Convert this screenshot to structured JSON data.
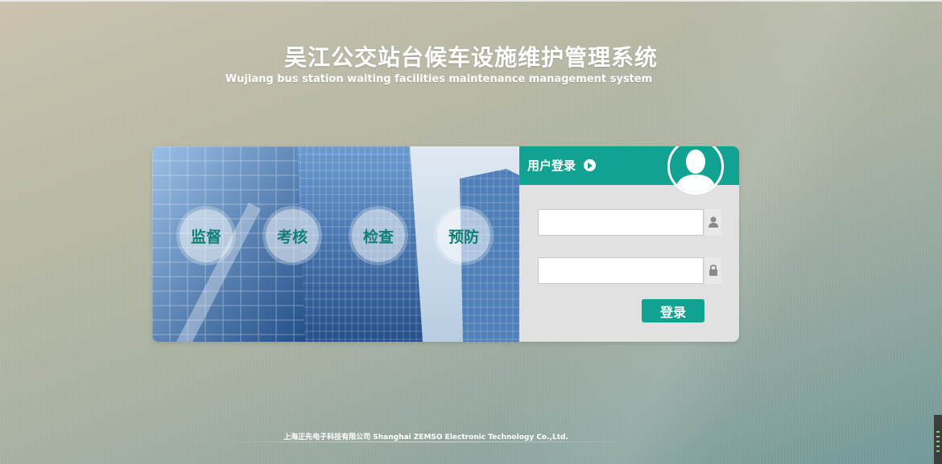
{
  "header": {
    "title_zh": "吴江公交站台候车设施维护管理系统",
    "title_en": "Wujiang bus station waiting facilities maintenance management system"
  },
  "banner": {
    "bubbles": [
      {
        "label": "监督"
      },
      {
        "label": "考核"
      },
      {
        "label": "检查"
      },
      {
        "label": "预防"
      }
    ]
  },
  "login": {
    "title": "用户登录",
    "username": {
      "value": "",
      "placeholder": "",
      "icon": "user-icon"
    },
    "password": {
      "value": "",
      "placeholder": "",
      "icon": "lock-icon"
    },
    "submit_label": "登录"
  },
  "footer": {
    "copyright": "上海正先电子科技有限公司 Shanghai ZEMSO Electronic Technology Co.,Ltd."
  },
  "colors": {
    "accent": "#11a291",
    "panel_bg": "#e1e1e1",
    "bubble_text": "#0f7f74"
  }
}
